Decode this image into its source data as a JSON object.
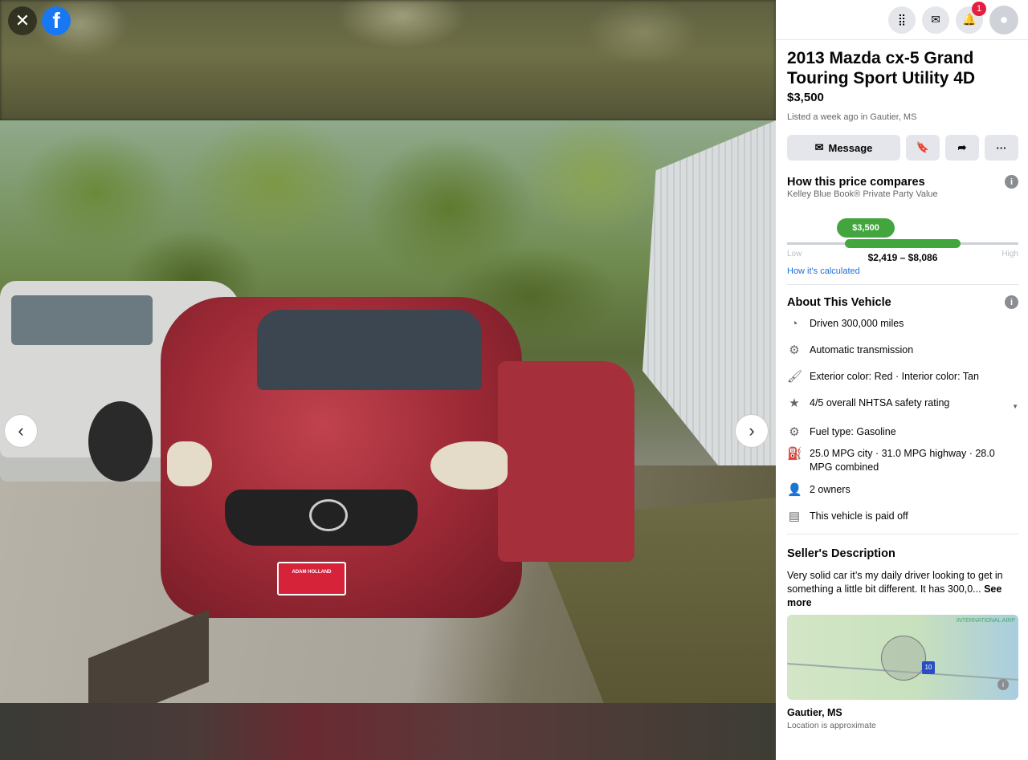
{
  "viewer": {
    "close_icon": "close-icon",
    "logo_letter": "f",
    "prev_glyph": "‹",
    "next_glyph": "›",
    "plate_text": "ADAM HOLLAND"
  },
  "topbar": {
    "notification_count": "1"
  },
  "listing": {
    "title": "2013 Mazda cx-5 Grand Touring Sport Utility 4D",
    "price": "$3,500",
    "listed": "Listed a week ago in Gautier, MS",
    "message_label": "Message",
    "more_glyph": "···"
  },
  "price_compare": {
    "title": "How this price compares",
    "subtitle": "Kelley Blue Book® Private Party Value",
    "price_pill": "$3,500",
    "low_label": "Low",
    "high_label": "High",
    "range": "$2,419 – $8,086",
    "calc_link": "How it's calculated",
    "accent": "#42a53d"
  },
  "about": {
    "title": "About This Vehicle",
    "items": [
      {
        "icon": "speedometer-icon",
        "glyph": "◔",
        "text": "Driven 300,000 miles"
      },
      {
        "icon": "engine-icon",
        "glyph": "⚙",
        "text": "Automatic transmission"
      },
      {
        "icon": "paint-icon",
        "glyph": "🖌",
        "text": "Exterior color: Red · Interior color: Tan"
      },
      {
        "icon": "star-icon",
        "glyph": "★",
        "text": "4/5 overall NHTSA safety rating"
      },
      {
        "icon": "engine-icon",
        "glyph": "⚙",
        "text": "Fuel type: Gasoline"
      },
      {
        "icon": "gas-pump-icon",
        "glyph": "⛽",
        "text": "25.0 MPG city · 31.0 MPG highway · 28.0 MPG combined"
      },
      {
        "icon": "person-icon",
        "glyph": "👤",
        "text": "2 owners"
      },
      {
        "icon": "document-icon",
        "glyph": "▤",
        "text": "This vehicle is paid off"
      }
    ]
  },
  "seller": {
    "title": "Seller's Description",
    "text": "Very solid car it’s my daily driver looking to get in something a little bit different. It has 300,0...",
    "see_more": "See more"
  },
  "map": {
    "label": "INTERNATIONAL AIRP",
    "highway": "10",
    "location": "Gautier, MS",
    "approx": "Location is approximate"
  }
}
